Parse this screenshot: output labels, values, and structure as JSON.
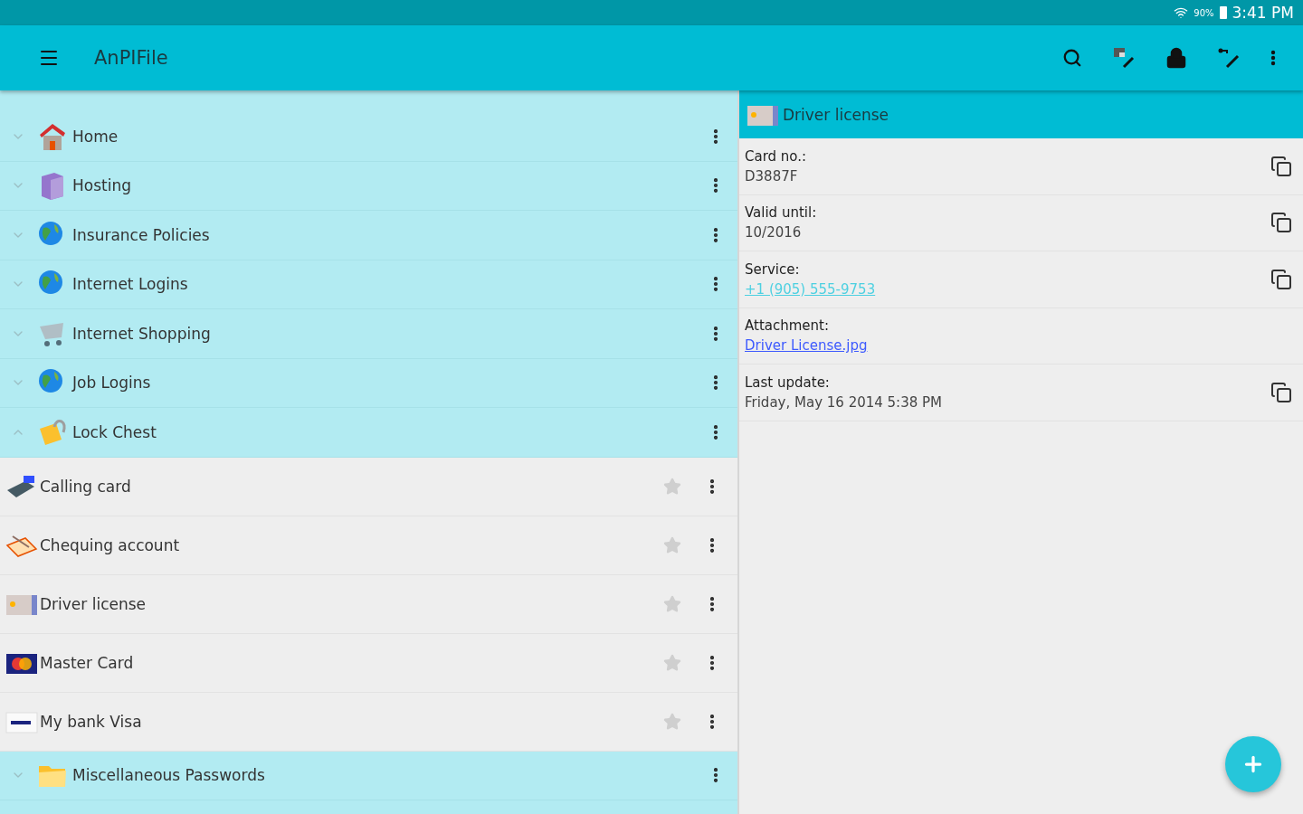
{
  "status_bar": {
    "battery": "90%",
    "time": "3:41 PM"
  },
  "toolbar": {
    "title": "AnPIFile"
  },
  "folders": [
    {
      "name": "Home",
      "expanded": false
    },
    {
      "name": "Hosting",
      "expanded": false
    },
    {
      "name": "Insurance Policies",
      "expanded": false
    },
    {
      "name": "Internet Logins",
      "expanded": false
    },
    {
      "name": "Internet Shopping",
      "expanded": false
    },
    {
      "name": "Job Logins",
      "expanded": false
    },
    {
      "name": "Lock Chest",
      "expanded": true
    }
  ],
  "items": [
    {
      "name": "Calling card",
      "favorite": false
    },
    {
      "name": "Chequing account",
      "favorite": false
    },
    {
      "name": "Driver license",
      "favorite": false
    },
    {
      "name": "Master Card",
      "favorite": false
    },
    {
      "name": "My bank Visa",
      "favorite": false
    }
  ],
  "folders_after": [
    {
      "name": "Miscellaneous Passwords",
      "expanded": false
    }
  ],
  "detail": {
    "title": "Driver license",
    "fields": [
      {
        "label": "Card no.:",
        "value": "D3887F",
        "kind": "text",
        "copyable": true
      },
      {
        "label": "Valid until:",
        "value": "10/2016",
        "kind": "text",
        "copyable": true
      },
      {
        "label": "Service:",
        "value": "+1 (905) 555-9753",
        "kind": "phone",
        "copyable": true
      },
      {
        "label": "Attachment:",
        "value": "Driver License.jpg",
        "kind": "link",
        "copyable": false
      },
      {
        "label": "Last update:",
        "value": "Friday, May 16 2014 5:38 PM",
        "kind": "text",
        "copyable": true
      }
    ]
  }
}
